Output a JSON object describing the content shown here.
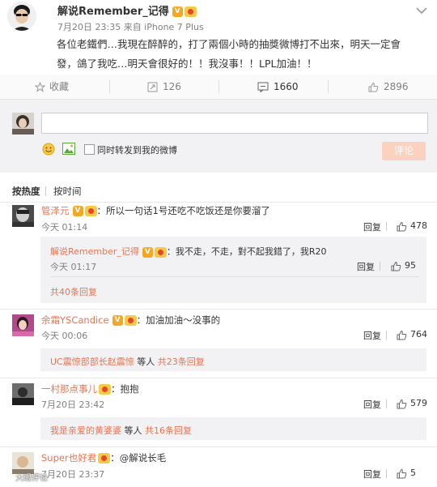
{
  "post": {
    "author": "解说Remember_记得",
    "timestamp": "7月20日 23:35 来自 iPhone 7 Plus",
    "text_line1": "各位老鐵們…我現在醉醉的，打了兩個小時的抽獎微博打不出來，明天一定會",
    "text_line2": "發，鴿了我吃…明天會很好的！！我沒事！！LPL加油！！"
  },
  "actions": {
    "collect_label": "收藏",
    "repost_count": "126",
    "comment_count": "1660",
    "like_count": "2896"
  },
  "composer": {
    "input_value": "",
    "also_repost_label": "同时转发到我的微博",
    "submit_label": "评论"
  },
  "sort": {
    "by_hot": "按热度",
    "by_time": "按时间"
  },
  "comments": [
    {
      "user": "管泽元",
      "text": "：所以一句话1号还吃不吃饭还是你要溜了",
      "time": "今天 01:14",
      "reply_label": "回复",
      "likes": "478",
      "sub": {
        "user": "解说Remember_记得",
        "text": "：我不走，不走，對不起我錯了，我R20",
        "time": "今天 01:17",
        "reply_label": "回复",
        "likes": "95",
        "more": "共40条回复"
      }
    },
    {
      "user": "余霜YSCandice",
      "text": "：加油加油～没事的",
      "time": "今天 00:06",
      "reply_label": "回复",
      "likes": "764",
      "summary_user": "UC震惊部部长赵震惊",
      "summary_mid": " 等人 ",
      "summary_count": "共23条回复"
    },
    {
      "user": "一村那点事儿",
      "text": "：抱抱",
      "time": "7月20日 23:42",
      "reply_label": "回复",
      "likes": "579",
      "summary_user": "我是亲爱的黄婆婆",
      "summary_mid": " 等人 ",
      "summary_count": "共16条回复"
    },
    {
      "user": "Super也好君",
      "text": "：@解说长毛",
      "time": "7月20日 23:37",
      "reply_label": "回复",
      "likes": "5"
    }
  ],
  "watermark": "大眼评论"
}
